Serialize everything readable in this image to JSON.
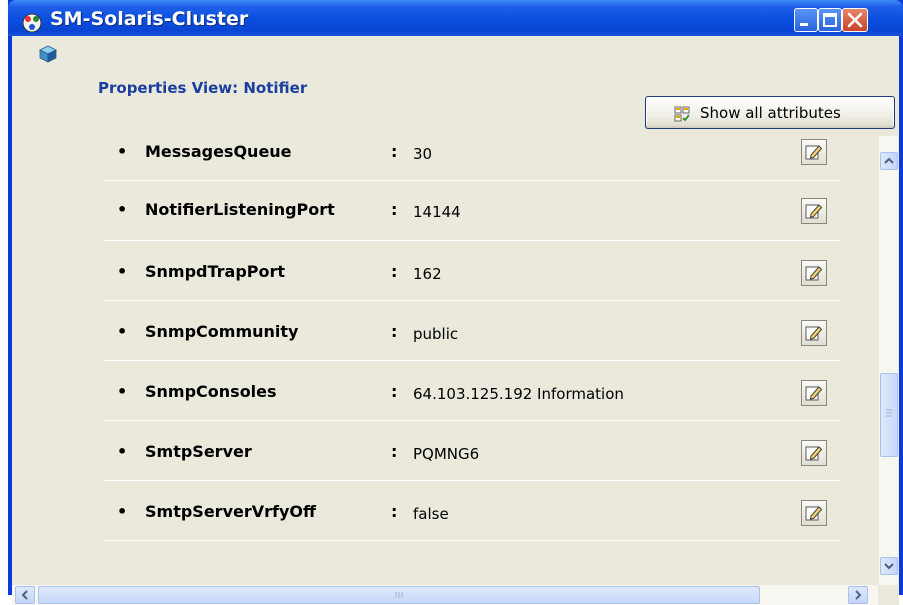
{
  "window": {
    "title": "SM-Solaris-Cluster",
    "icons": {
      "app": "cluster-app-icon",
      "minimize": "minimize-icon",
      "maximize": "maximize-icon",
      "close": "close-icon"
    }
  },
  "header": {
    "icon": "cube-icon",
    "title": "Properties View: Notifier"
  },
  "toolbar": {
    "show_all_label": "Show all attributes",
    "show_all_icon": "show-attributes-icon"
  },
  "properties": [
    {
      "name": "MessagesQueue",
      "colon": ":",
      "value": "30",
      "icon": "edit-icon"
    },
    {
      "name": "NotifierListeningPort",
      "colon": ":",
      "value": "14144",
      "icon": "edit-icon"
    },
    {
      "name": "SnmpdTrapPort",
      "colon": ":",
      "value": "162",
      "icon": "edit-icon"
    },
    {
      "name": "SnmpCommunity",
      "colon": ":",
      "value": "public",
      "icon": "edit-icon"
    },
    {
      "name": "SnmpConsoles",
      "colon": ":",
      "value": "64.103.125.192 Information",
      "icon": "edit-icon"
    },
    {
      "name": "SmtpServer",
      "colon": ":",
      "value": "PQMNG6",
      "icon": "edit-icon"
    },
    {
      "name": "SmtpServerVrfyOff",
      "colon": ":",
      "value": "false",
      "icon": "edit-icon"
    }
  ],
  "colors": {
    "titlebar": "#0a4ddf",
    "panel_bg": "#ebe9dc",
    "header_text": "#1a3fa0",
    "scrollbar": "#c3d5f8"
  }
}
